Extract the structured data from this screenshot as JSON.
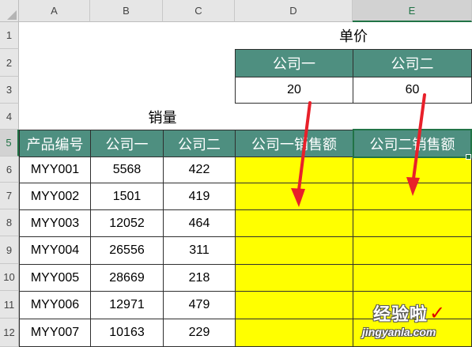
{
  "column_headers": [
    "A",
    "B",
    "C",
    "D",
    "E"
  ],
  "row_headers": [
    "1",
    "2",
    "3",
    "4",
    "5",
    "6",
    "7",
    "8",
    "9",
    "10",
    "11",
    "12"
  ],
  "selected_column": "E",
  "selected_row": "5",
  "price_table": {
    "title": "单价",
    "headers": [
      "公司一",
      "公司二"
    ],
    "values": [
      "20",
      "60"
    ]
  },
  "sales_title": "销量",
  "sales_table": {
    "headers": [
      "产品编号",
      "公司一",
      "公司二",
      "公司一销售额",
      "公司二销售额"
    ],
    "rows": [
      [
        "MYY001",
        "5568",
        "422"
      ],
      [
        "MYY002",
        "1501",
        "419"
      ],
      [
        "MYY003",
        "12052",
        "464"
      ],
      [
        "MYY004",
        "26556",
        "311"
      ],
      [
        "MYY005",
        "28669",
        "218"
      ],
      [
        "MYY006",
        "12971",
        "479"
      ],
      [
        "MYY007",
        "10163",
        "229"
      ]
    ]
  },
  "watermark": {
    "text": "经验啦",
    "check": "✓",
    "url": "jingyanla.com"
  },
  "colors": {
    "header_fill": "#4e8f80",
    "result_fill": "#ffff00",
    "arrow": "#e8202a",
    "selection": "#217346"
  }
}
